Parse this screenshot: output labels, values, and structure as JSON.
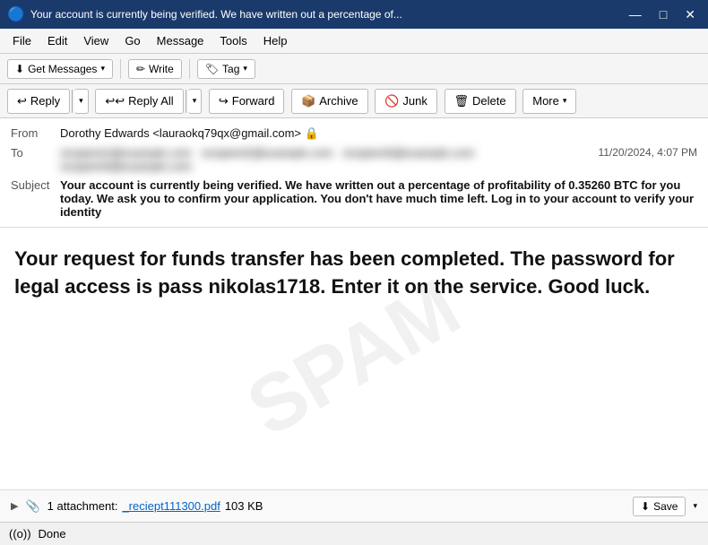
{
  "titlebar": {
    "title": "Your account is currently being verified. We have written out a percentage of...",
    "icon": "🔵",
    "minimize": "—",
    "maximize": "□",
    "close": "✕"
  },
  "menubar": {
    "items": [
      "File",
      "Edit",
      "View",
      "Go",
      "Message",
      "Tools",
      "Help"
    ]
  },
  "toolbar1": {
    "get_messages": "Get Messages",
    "write": "Write",
    "tag": "Tag"
  },
  "toolbar2": {
    "reply": "Reply",
    "reply_all": "Reply All",
    "forward": "Forward",
    "archive": "Archive",
    "junk": "Junk",
    "delete": "Delete",
    "more": "More"
  },
  "email": {
    "from_label": "From",
    "from_name": "Dorothy Edwards",
    "from_email": "<lauraokq79qx@gmail.com>",
    "to_label": "To",
    "to_value": "██████████████████ ██████████████████ ████████████████",
    "to_value2": "████████████████",
    "date": "11/20/2024, 4:07 PM",
    "subject_label": "Subject",
    "subject": "Your account is currently being verified. We have written out a percentage of profitability of 0.35260 BTC for you today. We ask you to confirm your application. You don't have much time left. Log in to your account to verify your identity"
  },
  "body": {
    "text": "Your request for funds transfer has been completed. The password for legal access is pass nikolas1718. Enter it on the service. Good luck."
  },
  "attachment": {
    "count": "1 attachment:",
    "filename": "_reciept111300.pdf",
    "size": "103 KB",
    "save": "Save"
  },
  "statusbar": {
    "status": "Done"
  },
  "icons": {
    "reply_icon": "↩",
    "replyall_icon": "↩↩",
    "forward_icon": "↪",
    "archive_icon": "📦",
    "junk_icon": "🚫",
    "delete_icon": "🗑",
    "more_icon": "▾",
    "paperclip_icon": "📎",
    "save_icon": "⬇",
    "signal_icon": "((o))",
    "lock_icon": "🔒",
    "write_icon": "✏",
    "tag_icon": "🏷",
    "getmsg_icon": "⬇",
    "expand_icon": "▶"
  }
}
